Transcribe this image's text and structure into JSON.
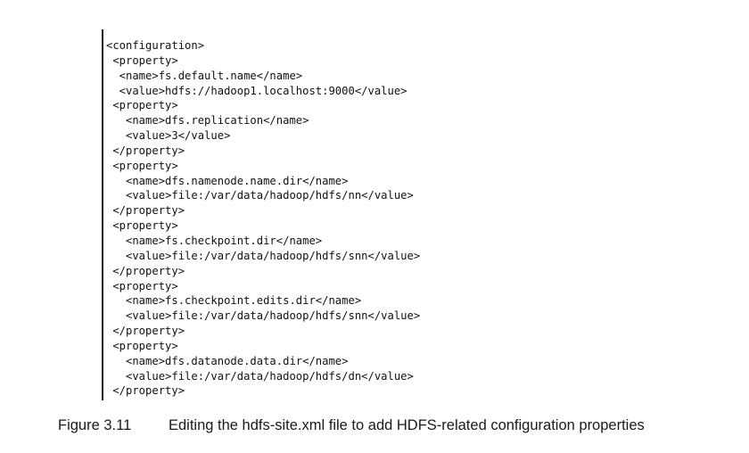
{
  "code": {
    "lines": [
      "<configuration>",
      " <property>",
      "  <name>fs.default.name</name>",
      "  <value>hdfs://hadoop1.localhost:9000</value>",
      " <property>",
      "   <name>dfs.replication</name>",
      "   <value>3</value>",
      " </property>",
      " <property>",
      "   <name>dfs.namenode.name.dir</name>",
      "   <value>file:/var/data/hadoop/hdfs/nn</value>",
      " </property>",
      " <property>",
      "   <name>fs.checkpoint.dir</name>",
      "   <value>file:/var/data/hadoop/hdfs/snn</value>",
      " </property>",
      " <property>",
      "   <name>fs.checkpoint.edits.dir</name>",
      "   <value>file:/var/data/hadoop/hdfs/snn</value>",
      " </property>",
      " <property>",
      "   <name>dfs.datanode.data.dir</name>",
      "   <value>file:/var/data/hadoop/hdfs/dn</value>",
      " </property>"
    ]
  },
  "caption": {
    "number": "Figure 3.11",
    "text": "Editing the hdfs-site.xml file to add HDFS-related configuration properties"
  }
}
